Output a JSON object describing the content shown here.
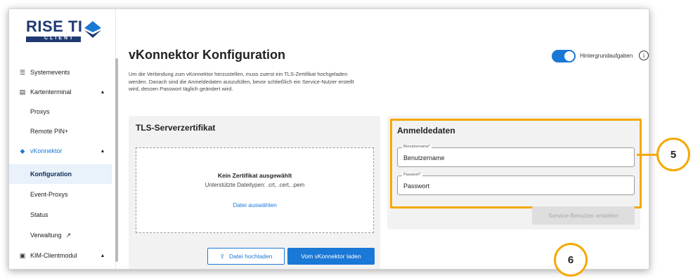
{
  "logo": {
    "brand": "RISE TI",
    "sub": "CLIENT"
  },
  "sidebar": {
    "items": [
      {
        "icon": "events-icon",
        "glyph": "☰",
        "label": "Systemevents",
        "chevron": ""
      },
      {
        "icon": "terminal-icon",
        "glyph": "▤",
        "label": "Kartenterminal",
        "chevron": "▲"
      },
      {
        "icon": "",
        "glyph": "",
        "label": "Proxys",
        "chevron": ""
      },
      {
        "icon": "",
        "glyph": "",
        "label": "Remote PIN+",
        "chevron": ""
      },
      {
        "icon": "vkonnektor-icon",
        "glyph": "◆",
        "label": "vKonnektor",
        "chevron": "▲"
      },
      {
        "icon": "",
        "glyph": "",
        "label": "Konfiguration",
        "chevron": ""
      },
      {
        "icon": "",
        "glyph": "",
        "label": "Event-Proxys",
        "chevron": ""
      },
      {
        "icon": "",
        "glyph": "",
        "label": "Status",
        "chevron": ""
      },
      {
        "icon": "",
        "glyph": "",
        "label": "Verwaltung",
        "chevron": ""
      },
      {
        "icon": "kim-icon",
        "glyph": "▣",
        "label": "KIM-Clientmodul",
        "chevron": "▲"
      }
    ],
    "external_glyph": "↗"
  },
  "header": {
    "title": "vKonnektor Konfiguration",
    "toggle_label": "Hintergrundaufgaben",
    "toggle_on": true,
    "info_glyph": "i"
  },
  "intro": "Um die Verbindung zum vKonnektor herzustellen, muss zuerst ein TLS-Zertifikat hochgeladen werden. Danach sind die Anmeldedaten auszufüllen, bevor schließlich ein Service-Nutzer erstellt wird, dessen Passwort täglich geändert wird.",
  "certificate": {
    "title": "TLS-Serverzertifikat",
    "empty_title": "Kein Zertifikat ausgewählt",
    "file_types": "Unterstützte Dateitypen: .crt, .cert, .pem",
    "select_link": "Datei auswählen",
    "upload_button": "Datei hochladen",
    "upload_glyph": "⇪",
    "load_button": "Vom vKonnektor laden"
  },
  "credentials": {
    "title": "Anmeldedaten",
    "username_label": "Benutzername*",
    "username_value": "Benutzername",
    "password_label": "Passwort*",
    "password_value": "Passwort",
    "create_button": "Service-Benutzer erstellen"
  },
  "callouts": {
    "first": "5",
    "second": "6"
  },
  "colors": {
    "accent": "#1a78d6",
    "highlight": "#f5a800",
    "brand": "#1f3a72"
  }
}
